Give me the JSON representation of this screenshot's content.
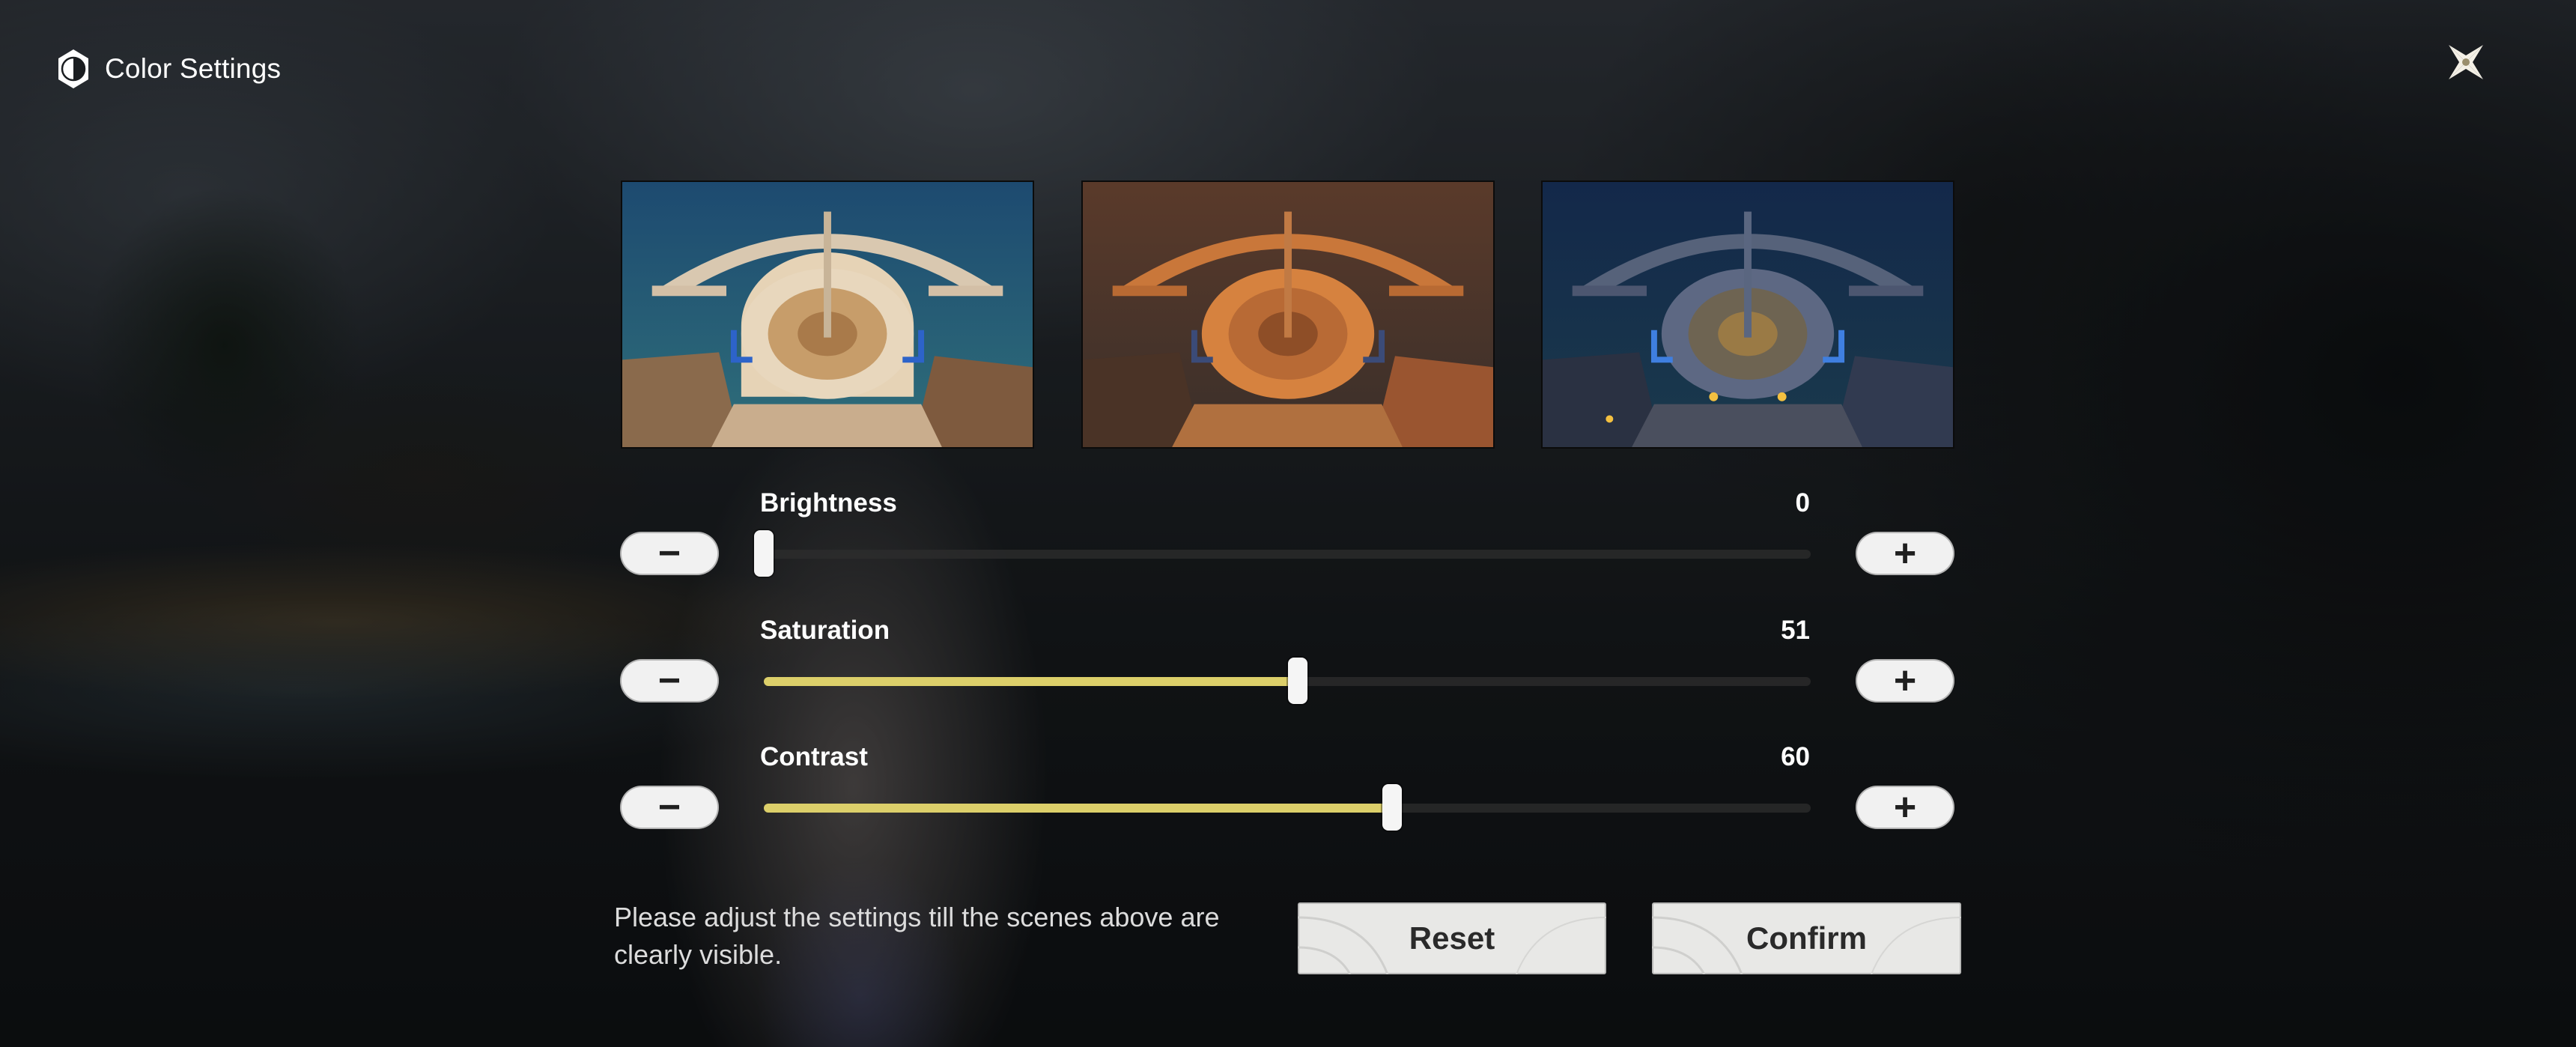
{
  "header": {
    "title": "Color Settings",
    "icon": "contrast-icon"
  },
  "close": {
    "icon": "close-icon"
  },
  "previews": [
    {
      "name": "preview-normal",
      "tone": "normal"
    },
    {
      "name": "preview-warm",
      "tone": "warm"
    },
    {
      "name": "preview-night",
      "tone": "night"
    }
  ],
  "settings": {
    "brightness": {
      "label": "Brightness",
      "value": "0",
      "min": 0,
      "max": 100
    },
    "saturation": {
      "label": "Saturation",
      "value": "51",
      "min": 0,
      "max": 100
    },
    "contrast": {
      "label": "Contrast",
      "value": "60",
      "min": 0,
      "max": 100
    }
  },
  "controls": {
    "minus": "−",
    "plus": "+"
  },
  "footer": {
    "hint": "Please adjust the settings till the scenes above are clearly visible.",
    "reset_label": "Reset",
    "confirm_label": "Confirm"
  },
  "colors": {
    "accent_fill": "#dccf6a",
    "button_bg": "#e8e8e6"
  }
}
